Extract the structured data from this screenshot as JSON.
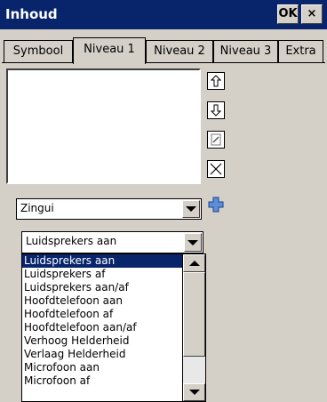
{
  "window": {
    "title": "Inhoud",
    "ok_label": "OK",
    "close_label": "×"
  },
  "tabs": [
    {
      "label": "Symbool"
    },
    {
      "label": "Niveau 1",
      "active": true
    },
    {
      "label": "Niveau 2"
    },
    {
      "label": "Niveau 3"
    },
    {
      "label": "Extra"
    }
  ],
  "side_buttons": [
    "arrow-up-icon",
    "arrow-down-icon",
    "edit-document-icon",
    "delete-x-icon",
    "add-plus-icon"
  ],
  "category_combo": {
    "value": "Zingui"
  },
  "action_combo": {
    "value": "Luidsprekers aan",
    "options": [
      "Luidsprekers aan",
      "Luidsprekers af",
      "Luidsprekers aan/af",
      "Hoofdtelefoon aan",
      "Hoofdtelefoon af",
      "Hoofdtelefoon aan/af",
      "Verhoog Helderheid",
      "Verlaag Helderheid",
      "Microfoon aan",
      "Microfoon af"
    ],
    "selected_index": 0
  },
  "colors": {
    "titlebar": "#08246b",
    "selection": "#08246b",
    "face": "#d4d0c8"
  }
}
